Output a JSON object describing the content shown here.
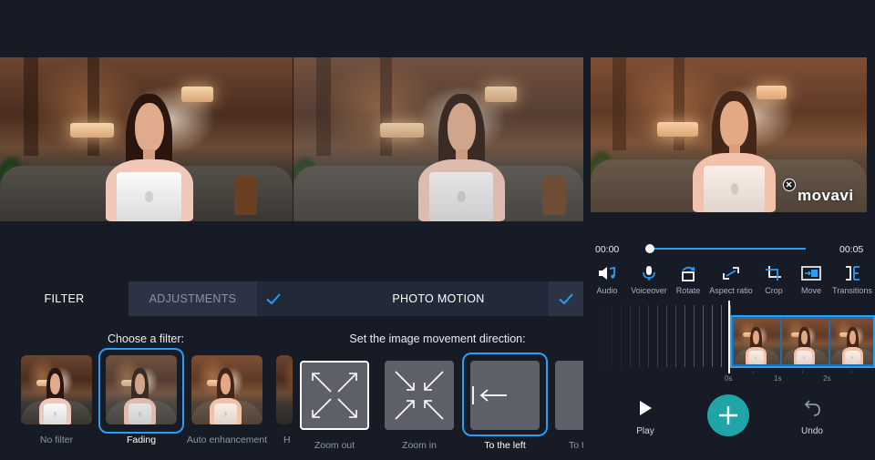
{
  "filter_tabs": {
    "filter": "FILTER",
    "adjustments": "ADJUSTMENTS"
  },
  "filter_prompt": "Choose a filter:",
  "filters": [
    {
      "label": "No filter"
    },
    {
      "label": "Fading",
      "selected": true
    },
    {
      "label": "Auto enhancement"
    },
    {
      "label": "H"
    }
  ],
  "photo_motion": {
    "title": "PHOTO MOTION",
    "prompt": "Set the image movement direction:",
    "options": [
      {
        "label": "Zoom out"
      },
      {
        "label": "Zoom in"
      },
      {
        "label": "To the left",
        "selected": true
      },
      {
        "label": "To t"
      }
    ]
  },
  "editor": {
    "watermark": "movavi",
    "time_start": "00:00",
    "time_end": "00:05",
    "playhead_progress": 0,
    "tools": [
      {
        "label": "Audio",
        "icon": "audio-icon"
      },
      {
        "label": "Voiceover",
        "icon": "microphone-icon"
      },
      {
        "label": "Rotate",
        "icon": "rotate-icon"
      },
      {
        "label": "Aspect ratio",
        "icon": "aspect-ratio-icon"
      },
      {
        "label": "Crop",
        "icon": "crop-icon"
      },
      {
        "label": "Move",
        "icon": "move-icon"
      },
      {
        "label": "Transitions",
        "icon": "transitions-icon"
      }
    ],
    "ruler": [
      "0s",
      "1s",
      "2s"
    ],
    "play_label": "Play",
    "undo_label": "Undo"
  },
  "colors": {
    "accent": "#2a9df4",
    "add_button": "#1fa5a8",
    "background": "#161b26"
  }
}
